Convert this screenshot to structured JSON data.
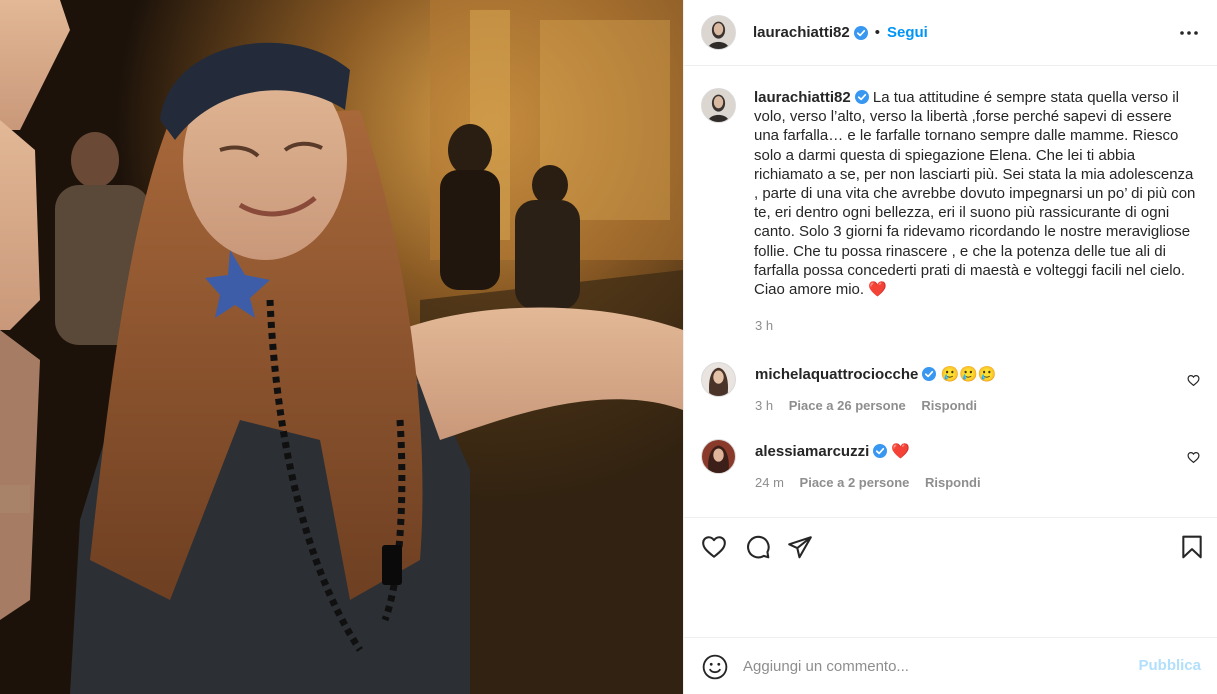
{
  "post_author": {
    "username": "laurachiatti82",
    "follow_label": "Segui",
    "separator": "•"
  },
  "caption": {
    "username": "laurachiatti82",
    "text": "La tua attitudine é sempre stata quella verso il volo, verso l’alto, verso la libertà ,forse perché sapevi di essere una farfalla… e le farfalle tornano sempre dalle mamme. Riesco solo a darmi questa di spiegazione Elena. Che lei ti abbia richiamato a se, per non lasciarti più. Sei stata la mia adolescenza , parte di una vita che avrebbe dovuto impegnarsi un po’ di più con te, eri dentro ogni bellezza, eri il suono più rassicurante di ogni canto. Solo 3 giorni fa ridevamo ricordando le nostre meravigliose follie. Che tu possa rinascere , e che la potenza delle tue ali di farfalla possa concederti prati di maestà e volteggi facili nel cielo. Ciao amore mio.",
    "emoji": "❤️",
    "time": "3 h"
  },
  "comments": [
    {
      "username": "michelaquattrociocche",
      "text": "🥲🥲🥲",
      "time": "3 h",
      "likes": "Piace a 26 persone",
      "reply": "Rispondi"
    },
    {
      "username": "alessiamarcuzzi",
      "text": "❤️",
      "time": "24 m",
      "likes": "Piace a 2 persone",
      "reply": "Rispondi"
    }
  ],
  "add_comment": {
    "placeholder": "Aggiungi un commento...",
    "publish_label": "Pubblica"
  },
  "icons": {
    "like": "heart-icon",
    "comment": "comment-icon",
    "share": "share-icon",
    "save": "bookmark-icon",
    "more": "more-options-icon",
    "emoji": "emoji-icon",
    "verified": "verified-badge-icon"
  },
  "colors": {
    "accent": "#0095f6",
    "publish_disabled": "#b2dffc",
    "verified": "#3897f0",
    "secondary_text": "#8e8e8e"
  }
}
